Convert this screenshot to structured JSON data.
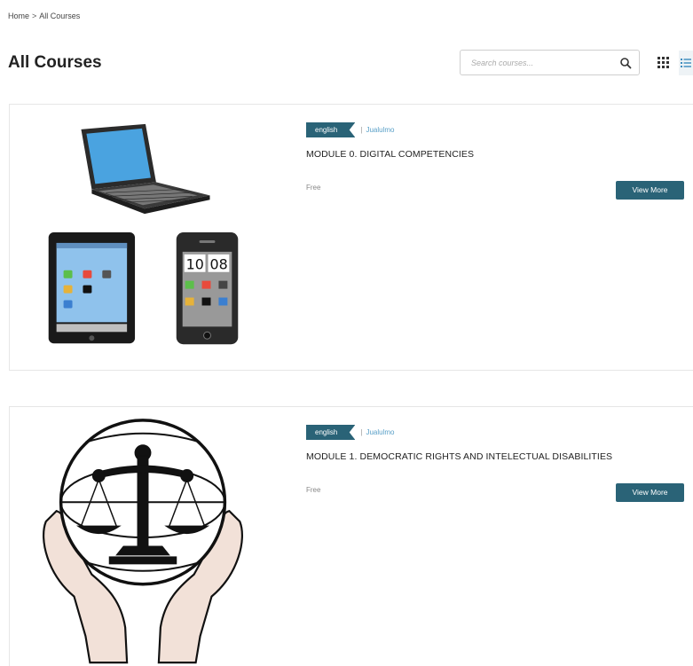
{
  "breadcrumb": {
    "home": "Home",
    "separator": ">",
    "current": "All Courses"
  },
  "page": {
    "title": "All Courses"
  },
  "search": {
    "placeholder": "Search courses..."
  },
  "view_toggle": {
    "grid_icon": "grid-icon",
    "list_icon": "list-icon"
  },
  "colors": {
    "accent": "#2a6377",
    "link": "#5aa0c8"
  },
  "courses": [
    {
      "language": "english",
      "instructor": "Jualulmo",
      "title": "MODULE 0. DIGITAL COMPETENCIES",
      "price": "Free",
      "button": "View More",
      "image": "devices-illustration"
    },
    {
      "language": "english",
      "instructor": "Jualulmo",
      "title": "MODULE 1.  DEMOCRATIC RIGHTS AND INTELECTUAL DISABILITIES",
      "price": "Free",
      "button": "View More",
      "image": "justice-scales-illustration"
    }
  ]
}
